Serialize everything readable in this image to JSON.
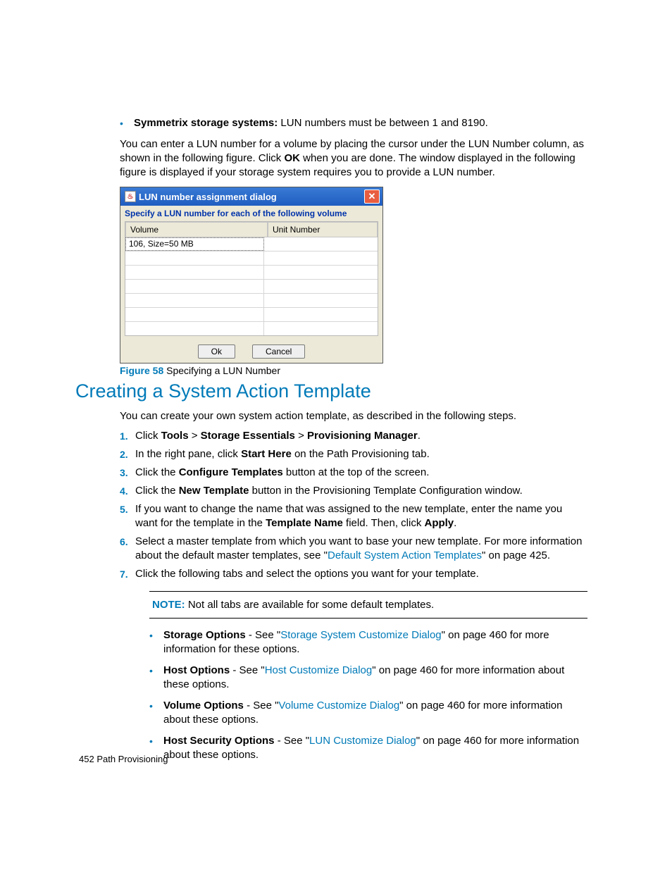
{
  "intro": {
    "bullet_label": "Symmetrix storage systems:",
    "bullet_text": " LUN numbers must be between 1 and 8190.",
    "para1_a": "You can enter a LUN number for a volume by placing the cursor under the LUN Number column, as shown in the following figure. Click ",
    "para1_bold": "OK",
    "para1_b": " when you are done. The window displayed in the following figure is displayed if your storage system requires you to provide a LUN number."
  },
  "dialog": {
    "title": "LUN number assignment dialog",
    "subtitle": "Specify a LUN number for each of the following volume",
    "col_volume": "Volume",
    "col_unit": "Unit Number",
    "row1": "106, Size=50 MB",
    "ok": "Ok",
    "cancel": "Cancel"
  },
  "figure": {
    "label": "Figure 58",
    "caption": "  Specifying a LUN Number"
  },
  "section_title": "Creating a System Action Template",
  "section_intro": "You can create your own system action template, as described in the following steps.",
  "steps": {
    "s1_a": "Click ",
    "s1_b": "Tools",
    "s1_c": " > ",
    "s1_d": "Storage Essentials",
    "s1_e": " > ",
    "s1_f": "Provisioning Manager",
    "s1_g": ".",
    "s2_a": "In the right pane, click ",
    "s2_b": "Start Here",
    "s2_c": " on the Path Provisioning tab.",
    "s3_a": "Click the ",
    "s3_b": "Configure Templates",
    "s3_c": " button at the top of the screen.",
    "s4_a": "Click the ",
    "s4_b": "New Template",
    "s4_c": " button in the Provisioning Template Configuration window.",
    "s5_a": "If you want to change the name that was assigned to the new template, enter the name you want for the template in the ",
    "s5_b": "Template Name",
    "s5_c": " field. Then, click ",
    "s5_d": "Apply",
    "s5_e": ".",
    "s6_a": "Select a master template from which you want to base your new template. For more information about the default master templates, see \"",
    "s6_link": "Default System Action Templates",
    "s6_b": "\" on page 425.",
    "s7": "Click the following tabs and select the options you want for your template."
  },
  "note": {
    "label": "NOTE:",
    "text": "   Not all tabs are available for some default templates."
  },
  "options": {
    "o1_b": "Storage Options",
    "o1_a": " - See \"",
    "o1_link": "Storage System Customize Dialog",
    "o1_c": "\" on page 460 for more information for these options.",
    "o2_b": "Host Options",
    "o2_a": " - See \"",
    "o2_link": "Host Customize Dialog",
    "o2_c": "\" on page 460 for more information about these options.",
    "o3_b": "Volume Options",
    "o3_a": " - See \"",
    "o3_link": "Volume Customize Dialog",
    "o3_c": "\" on page 460 for more information about these options.",
    "o4_b": "Host Security Options",
    "o4_a": " - See \"",
    "o4_link": "LUN Customize Dialog",
    "o4_c": "\" on page 460 for more information about these options."
  },
  "footer": {
    "page": "452",
    "section": "  Path Provisioning"
  }
}
